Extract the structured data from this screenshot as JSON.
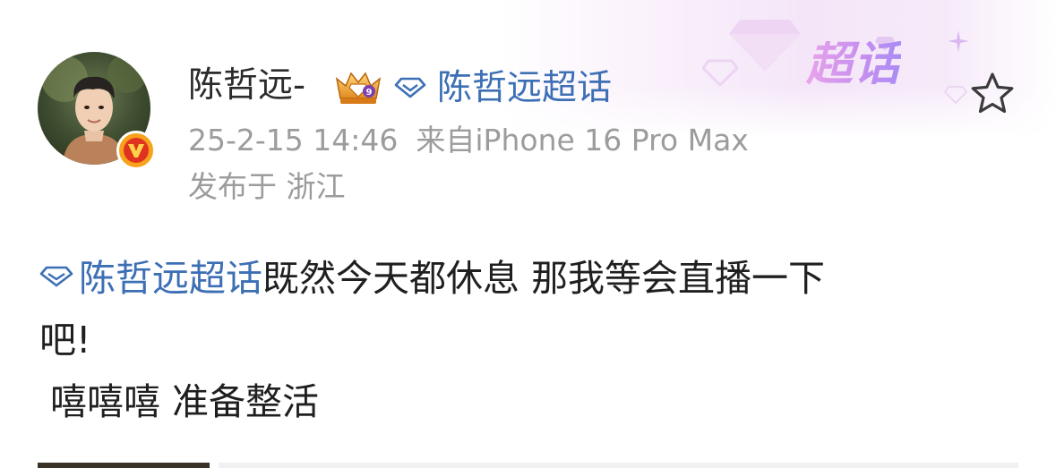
{
  "header": {
    "username": "陈哲远-",
    "topic_link": "陈哲远超话",
    "timestamp": "25-2-15 14:46",
    "source": "来自iPhone 16 Pro Max",
    "location": "发布于 浙江",
    "badge_text": "超话",
    "crown_level": "9",
    "icons": {
      "crown": "vip-crown-icon",
      "gem": "supertopic-diamond-icon",
      "star": "star-outline-icon",
      "verified": "verified-v-icon"
    }
  },
  "post": {
    "lines": [
      {
        "topic": "陈哲远超话",
        "text": "既然今天都休息 那我等会直播一下"
      },
      {
        "text": "吧!"
      },
      {
        "text": "嘻嘻嘻 准备整活"
      }
    ]
  },
  "colors": {
    "link": "#3d6fb5",
    "meta": "#9c9c9c",
    "text": "#1f1f1f",
    "badge_gradient_start": "#e9a3ea",
    "badge_gradient_end": "#a98cf5"
  }
}
